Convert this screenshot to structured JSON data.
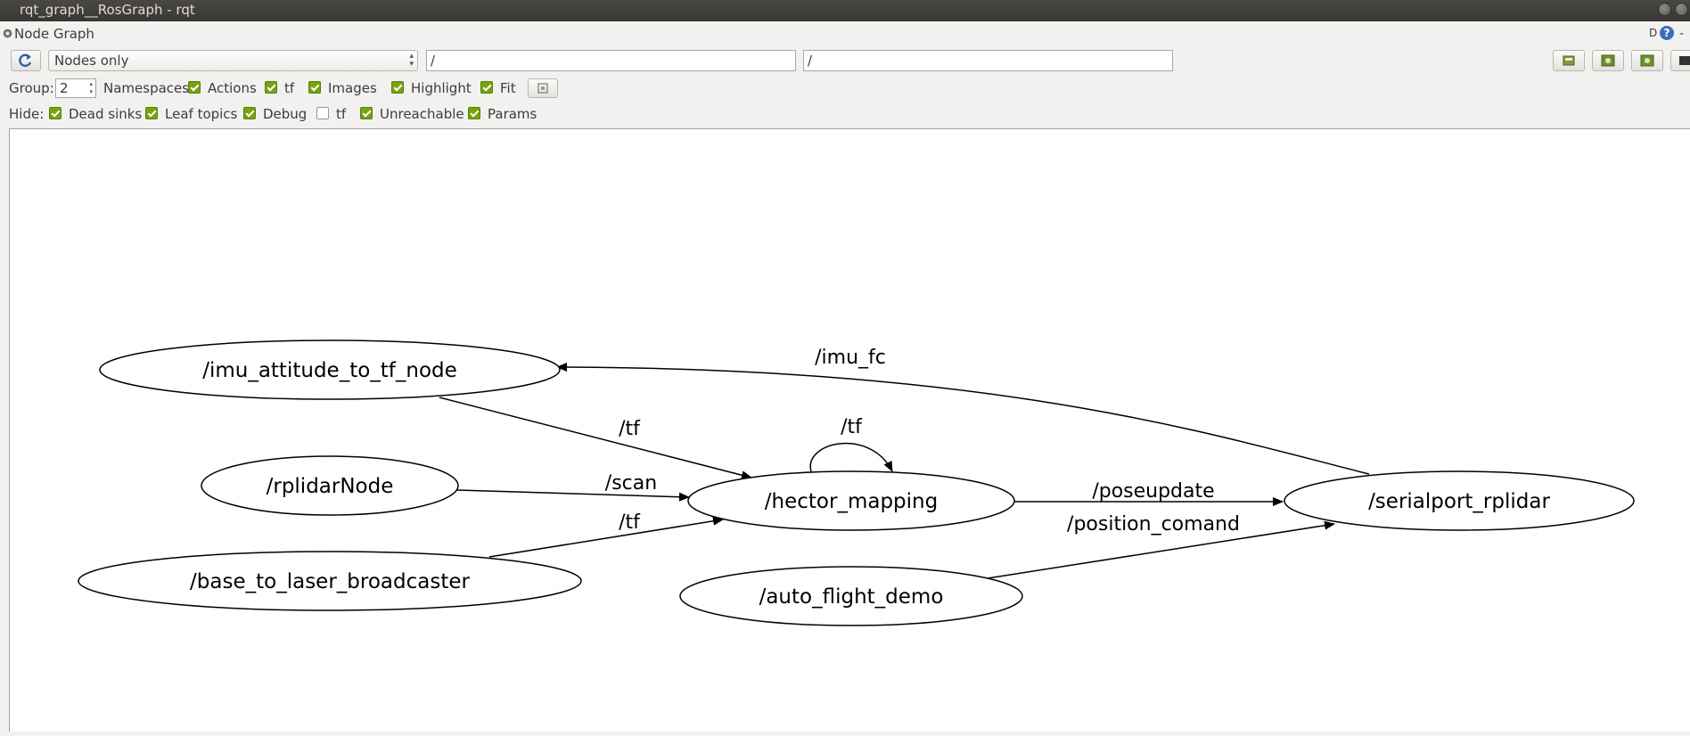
{
  "window": {
    "title": "rqt_graph__RosGraph - rqt"
  },
  "plugin": {
    "title": "Node Graph",
    "right_label": "D",
    "help_glyph": "?",
    "close_glyph": "-"
  },
  "toolbar": {
    "refresh_icon": "refresh-icon",
    "mode_value": "Nodes only",
    "node_filter_value": "/",
    "topic_filter_value": "/",
    "icons": [
      "load-icon",
      "save-dot-icon",
      "save-svg-icon",
      "screenshot-icon"
    ]
  },
  "group_row": {
    "group_label": "Group:",
    "group_value": "2",
    "options": [
      {
        "label": "Namespaces",
        "checked": true
      },
      {
        "label": "Actions",
        "checked": true
      },
      {
        "label": "tf",
        "checked": true
      },
      {
        "label": "Images",
        "checked": true
      },
      {
        "label": "Highlight",
        "checked": true
      },
      {
        "label": "Fit",
        "checked": true
      }
    ],
    "fit_button_icon": "fit-view-icon"
  },
  "hide_row": {
    "hide_label": "Hide:",
    "options": [
      {
        "label": "Dead sinks",
        "checked": true
      },
      {
        "label": "Leaf topics",
        "checked": true
      },
      {
        "label": "Debug",
        "checked": true
      },
      {
        "label": "tf",
        "checked": false
      },
      {
        "label": "Unreachable",
        "checked": true
      },
      {
        "label": "Params",
        "checked": true
      }
    ]
  },
  "graph": {
    "nodes": {
      "imu": "/imu_attitude_to_tf_node",
      "rplidar": "/rplidarNode",
      "base": "/base_to_laser_broadcaster",
      "hector": "/hector_mapping",
      "auto": "/auto_flight_demo",
      "serial": "/serialport_rplidar"
    },
    "edges": {
      "imu_fc": "/imu_fc",
      "tf_imu": "/tf",
      "tf_self": "/tf",
      "scan": "/scan",
      "tf_base": "/tf",
      "poseupdate": "/poseupdate",
      "position_comand": "/position_comand"
    }
  }
}
